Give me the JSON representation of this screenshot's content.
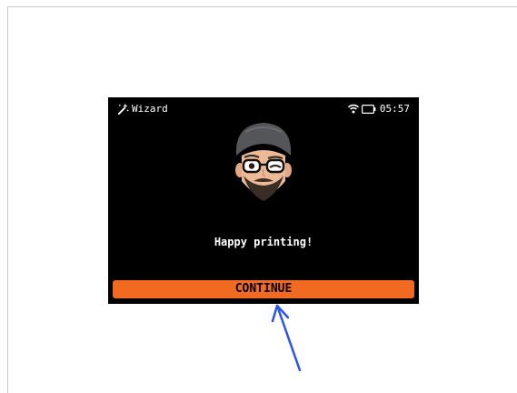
{
  "status_bar": {
    "title": "Wizard",
    "title_icon": "wizard-wand-icon",
    "wifi_icon": "wifi-icon",
    "battery_icon": "battery-icon",
    "time": "05:57"
  },
  "main": {
    "avatar": "winking-avatar-illustration",
    "message": "Happy printing!"
  },
  "actions": {
    "continue_label": "CONTINUE"
  },
  "annotation": {
    "pointer": "blue-arrow-icon"
  },
  "colors": {
    "screen_background": "#000000",
    "button_accent": "#f26922",
    "annotation_arrow": "#2b55e6"
  }
}
